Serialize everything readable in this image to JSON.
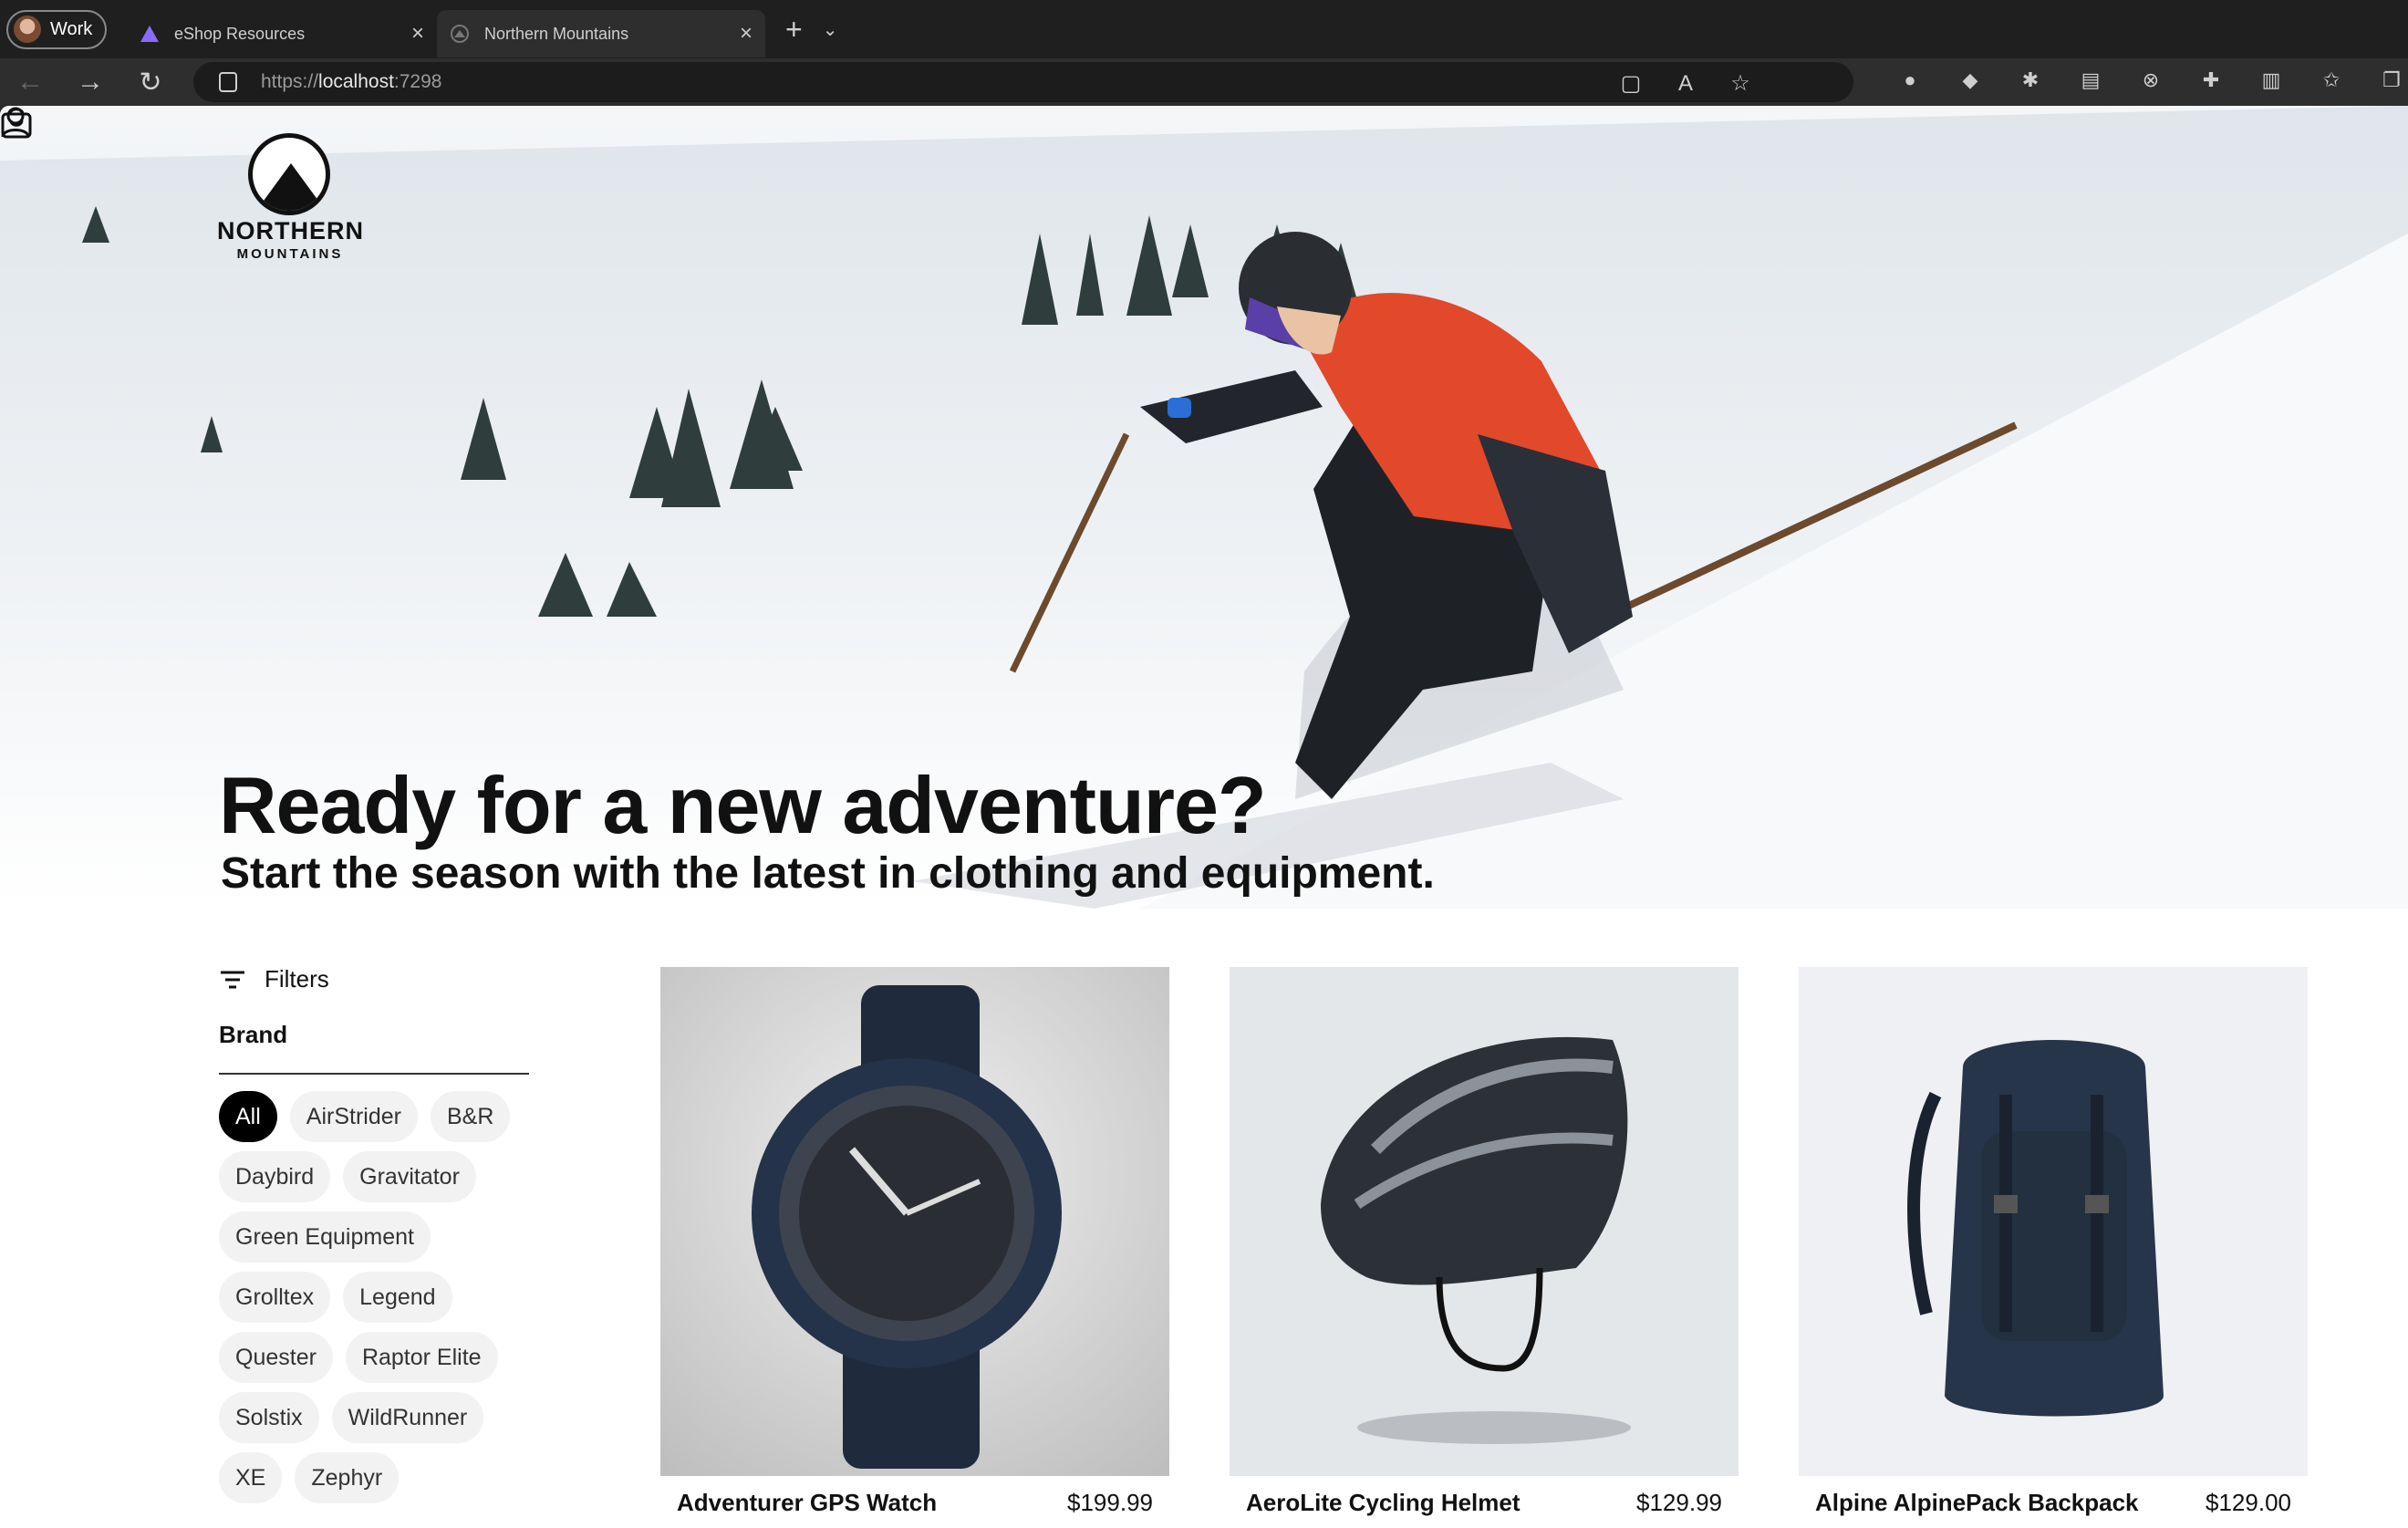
{
  "browser": {
    "profile_label": "Work",
    "tabs": [
      {
        "title": "eShop Resources"
      },
      {
        "title": "Northern Mountains"
      }
    ],
    "url_prefix": "https://",
    "url_host": "localhost",
    "url_port": ":7298"
  },
  "site": {
    "logo_line1": "NORTHERN",
    "logo_line2": "MOUNTAINS",
    "headline": "Ready for a new adventure?",
    "subheadline": "Start the season with the latest in clothing and equipment."
  },
  "filters": {
    "label": "Filters",
    "brand_label": "Brand",
    "brands": [
      "All",
      "AirStrider",
      "B&R",
      "Daybird",
      "Gravitator",
      "Green Equipment",
      "Grolltex",
      "Legend",
      "Quester",
      "Raptor Elite",
      "Solstix",
      "WildRunner",
      "XE",
      "Zephyr"
    ],
    "selected": "All"
  },
  "products": [
    {
      "name": "Adventurer GPS Watch",
      "price": "$199.99"
    },
    {
      "name": "AeroLite Cycling Helmet",
      "price": "$129.99"
    },
    {
      "name": "Alpine AlpinePack Backpack",
      "price": "$129.00"
    }
  ],
  "colors": {
    "accent": "#000000",
    "chip_bg": "#f2f2f2",
    "jacket": "#e2482a"
  }
}
